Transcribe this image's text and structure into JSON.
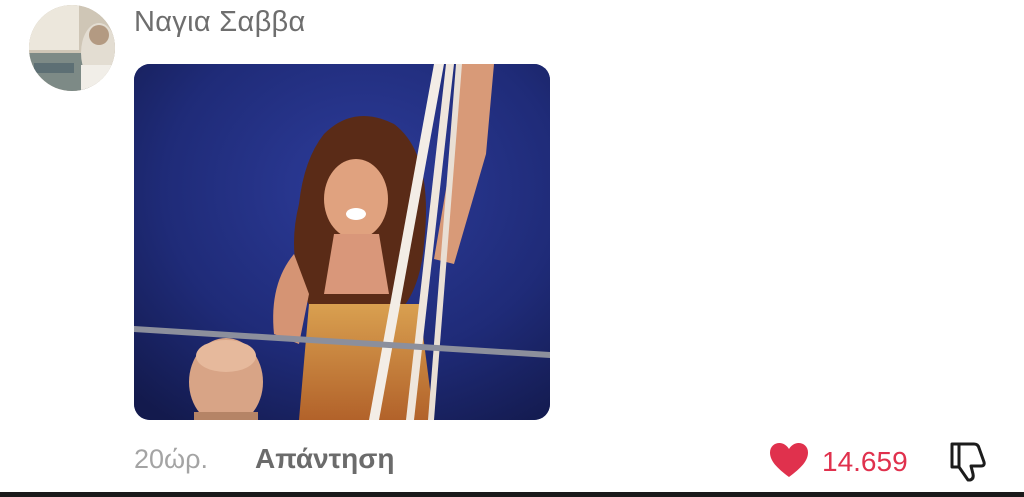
{
  "comment": {
    "author": "Ναγια Σαββα",
    "time": "20ώρ.",
    "reply_label": "Απάντηση",
    "likes": "14.659",
    "liked": true
  },
  "icons": {
    "like": "heart-icon",
    "dislike": "thumbs-down-icon"
  },
  "colors": {
    "like_accent": "#e0314d",
    "author_text": "#6e6e6e",
    "meta_text": "#a4a4a4"
  }
}
